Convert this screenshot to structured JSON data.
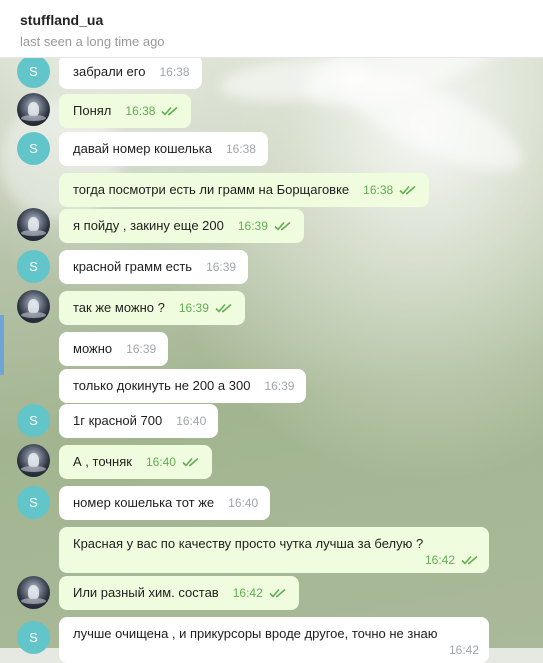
{
  "header": {
    "title": "stuffland_ua",
    "status": "last seen a long time ago"
  },
  "avatar_letter": "S",
  "messages": [
    {
      "text": "забрали его",
      "time": "16:38",
      "dir": "in"
    },
    {
      "text": "Понял",
      "time": "16:38",
      "dir": "out"
    },
    {
      "text": "давай номер кошелька",
      "time": "16:38",
      "dir": "in"
    },
    {
      "text": "тогда посмотри есть ли грамм на Борщаговке",
      "time": "16:38",
      "dir": "out"
    },
    {
      "text": "я пойду , закину еще 200",
      "time": "16:39",
      "dir": "out"
    },
    {
      "text": "красной грамм есть",
      "time": "16:39",
      "dir": "in"
    },
    {
      "text": "так же можно ?",
      "time": "16:39",
      "dir": "out"
    },
    {
      "text": "можно",
      "time": "16:39",
      "dir": "in"
    },
    {
      "text": "только докинуть не 200 а 300",
      "time": "16:39",
      "dir": "in"
    },
    {
      "text": "1г красной 700",
      "time": "16:40",
      "dir": "in"
    },
    {
      "text": "А , точняк",
      "time": "16:40",
      "dir": "out"
    },
    {
      "text": "номер кошелька тот же",
      "time": "16:40",
      "dir": "in"
    },
    {
      "text": "Красная у вас по качеству просто чутка лучша за белую ?",
      "time": "16:42",
      "dir": "out"
    },
    {
      "text": "Или разный хим. состав",
      "time": "16:42",
      "dir": "out"
    },
    {
      "text": "лучше очищена , и прикурсоры вроде другое, точно не знаю",
      "time": "16:42",
      "dir": "in"
    }
  ],
  "colors": {
    "incoming_bubble": "#ffffff",
    "outgoing_bubble": "#effdde",
    "read_check": "#62ac55",
    "avatar_s": "#62c5c9"
  },
  "icons": {
    "read_receipt": "double-check-icon"
  }
}
